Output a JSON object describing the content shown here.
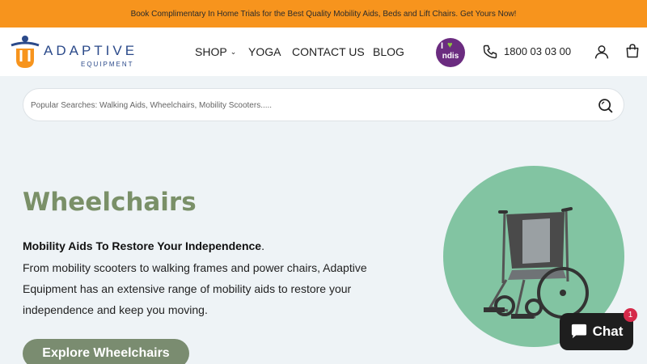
{
  "promo_bar": {
    "text": "Book Complimentary In Home Trials for the Best Quality Mobility Aids, Beds and Lift Chairs. Get Yours Now!"
  },
  "header": {
    "logo": {
      "word": "ADAPTIVE",
      "sub": "EQUIPMENT"
    },
    "nav": [
      {
        "label": "SHOP",
        "has_dropdown": true
      },
      {
        "label": "YOGA"
      },
      {
        "label": "CONTACT US"
      },
      {
        "label": "BLOG"
      }
    ],
    "ndis_badge": {
      "line1": "I",
      "line2": "ndis"
    },
    "phone": "1800 03 03 00",
    "icons": [
      "phone-icon",
      "account-icon",
      "cart-icon"
    ]
  },
  "search": {
    "placeholder": "Popular Searches: Walking Aids, Wheelchairs, Mobility Scooters.....",
    "icon": "search-icon"
  },
  "hero": {
    "title": "Wheelchairs",
    "lead_bold": "Mobility Aids To Restore Your Independence",
    "lead_end": ".",
    "body": "From mobility scooters to walking frames and power chairs, Adaptive Equipment has an extensive range of mobility aids to restore your independence and keep you moving.",
    "cta_label": "Explore Wheelchairs",
    "image": "wheelchair"
  },
  "chat": {
    "label": "Chat",
    "badge_count": "1"
  },
  "colors": {
    "promo_bg": "#f7941d",
    "brand_blue": "#2b4a8a",
    "hero_title": "#7a9068",
    "cta_bg": "#7a8c70",
    "circle_bg": "#82c4a2",
    "ndis_purple": "#6b2c80"
  }
}
